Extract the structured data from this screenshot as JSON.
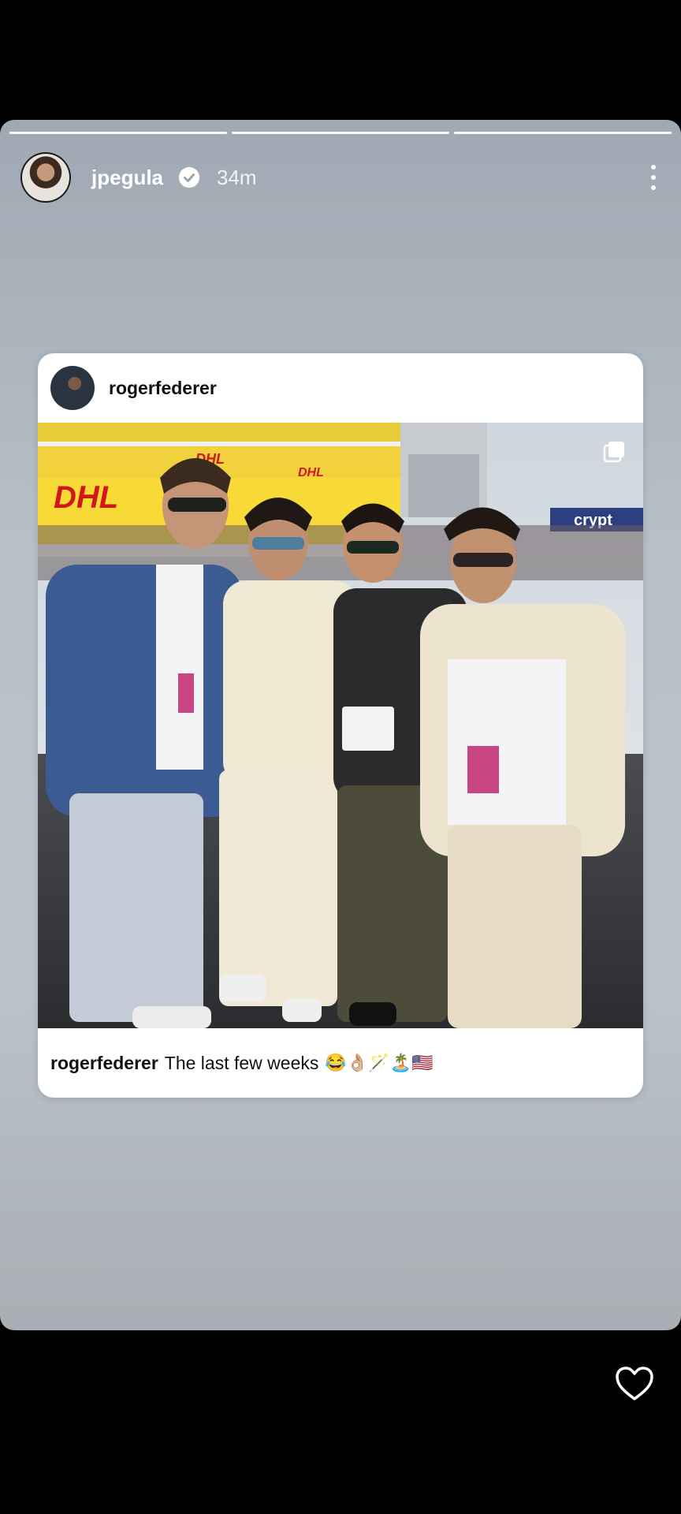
{
  "story": {
    "username": "jpegula",
    "time": "34m",
    "progress_segments": 3
  },
  "post": {
    "username": "rogerfederer",
    "caption_user": "rogerfederer",
    "caption_text": "The last few weeks",
    "caption_emojis": "😂👌🏼🪄🏝️🇺🇸"
  },
  "photo": {
    "signage": "DHL",
    "signage_right": "crypt"
  },
  "icons": {
    "verified": "verified-badge-icon",
    "more": "more-options-icon",
    "multi": "multiple-photos-icon",
    "like": "heart-icon"
  }
}
